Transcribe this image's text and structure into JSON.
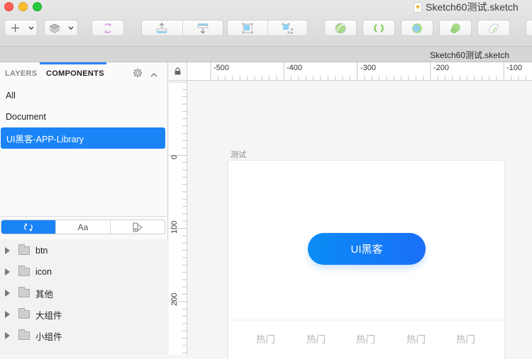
{
  "window": {
    "title": "Sketch60测试.sketch",
    "doc_icon": "sketch-file-icon"
  },
  "toolbar": {
    "insert_icon": "plus-icon",
    "layers_icon": "layers-stack-icon",
    "buttons": [
      {
        "name": "sync-button",
        "icon": "sync-icon"
      },
      {
        "name": "forward-button",
        "icon": "move-forward-icon"
      },
      {
        "name": "backward-button",
        "icon": "move-backward-icon"
      },
      {
        "name": "group-button",
        "icon": "group-icon"
      },
      {
        "name": "ungroup-button",
        "icon": "ungroup-icon"
      },
      {
        "name": "union-button",
        "icon": "union-icon"
      },
      {
        "name": "subtract-button",
        "icon": "subtract-icon"
      },
      {
        "name": "intersect-button",
        "icon": "intersect-icon"
      },
      {
        "name": "difference-button",
        "icon": "difference-icon"
      },
      {
        "name": "flatten-button",
        "icon": "flatten-icon"
      }
    ]
  },
  "subbar": {
    "title": "Sketch60测试.sketch"
  },
  "sidebar": {
    "tabs": {
      "layers": "LAYERS",
      "components": "COMPONENTS"
    },
    "libraries": [
      {
        "label": "All",
        "selected": false
      },
      {
        "label": "Document",
        "selected": false
      },
      {
        "label": "UI黑客-APP-Library",
        "selected": true
      }
    ],
    "segments": [
      {
        "label": "",
        "icon": "symbols-sync-icon",
        "active": true
      },
      {
        "label": "Aa",
        "icon": "text-styles-icon",
        "active": false
      },
      {
        "label": "",
        "icon": "layer-styles-icon",
        "active": false
      }
    ],
    "folders": [
      {
        "label": "btn"
      },
      {
        "label": "icon"
      },
      {
        "label": "其他"
      },
      {
        "label": "大组件"
      },
      {
        "label": "小组件"
      }
    ]
  },
  "canvas": {
    "ruler_h": [
      "-500",
      "-400",
      "-300",
      "-200",
      "-100"
    ],
    "ruler_v": [
      "0",
      "100",
      "200"
    ],
    "artboard": {
      "name": "测试",
      "button_label": "UI黑客",
      "tabbar_items": [
        "热门",
        "热门",
        "热门",
        "热门",
        "热门"
      ]
    }
  }
}
